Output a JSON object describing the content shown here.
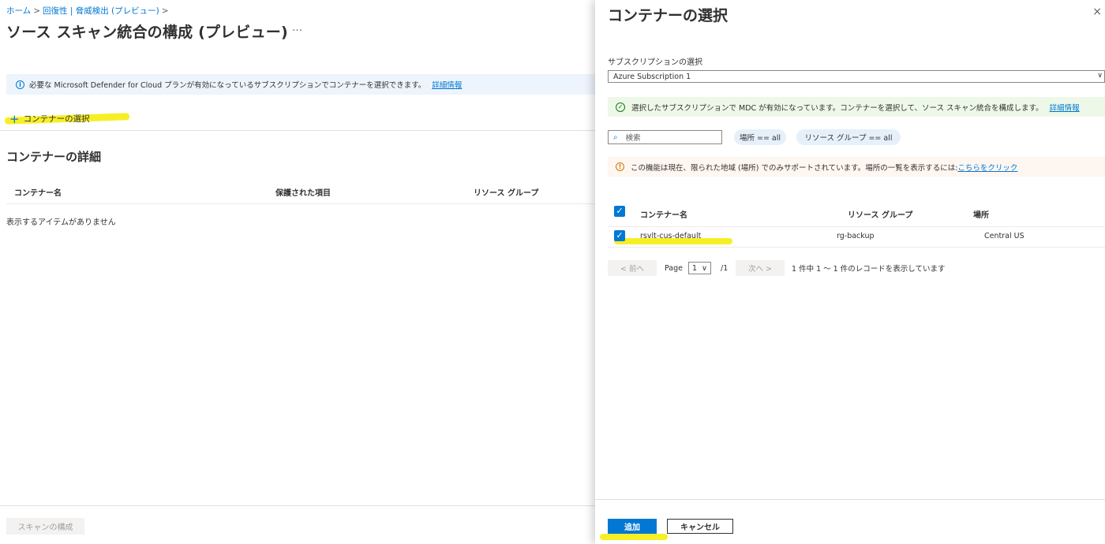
{
  "breadcrumb": {
    "home": "ホーム",
    "sep": ">",
    "resilience": "回復性 | 脅威検出 (プレビュー)",
    "tail": ">"
  },
  "page": {
    "title": "ソース スキャン統合の構成 (プレビュー)",
    "more": "…"
  },
  "info": {
    "text": "必要な Microsoft Defender for Cloud プランが有効になっているサブスクリプションでコンテナーを選択できます。",
    "link": "詳細情報",
    "icon": "i"
  },
  "toolbar": {
    "add_label": "コンテナーの選択",
    "add_icon": "+"
  },
  "details": {
    "title": "コンテナーの詳細",
    "columns": [
      "コンテナー名",
      "保護された項目",
      "リソース グループ"
    ],
    "empty": "表示するアイテムがありません"
  },
  "footer": {
    "scan_label": "スキャンの構成"
  },
  "panel": {
    "title": "コンテナーの選択",
    "close": "×",
    "subscription_label": "サブスクリプションの選択",
    "subscription_value": "Azure Subscription 1",
    "ok_text": "選択したサブスクリプションで MDC が有効になっています。コンテナーを選択して、ソース スキャン統合を構成します。",
    "ok_link": "詳細情報",
    "search_placeholder": "検索",
    "filters": [
      "場所 == all",
      "リソース グループ == all"
    ],
    "warn_text": "この機能は現在、限られた地域 (場所) でのみサポートされています。場所の一覧を表示するには: ",
    "warn_link": "こちらをクリック",
    "table": {
      "headers": [
        "コンテナー名",
        "リソース グループ",
        "場所"
      ],
      "rows": [
        {
          "name": "rsvlt-cus-default",
          "group": "rg-backup",
          "location": "Central US"
        }
      ]
    },
    "pagination": {
      "prev": "< 前へ",
      "page_label": "Page",
      "page": "1",
      "of": "/1",
      "next": "次へ >",
      "summary": "1 件中 1 ～ 1 件のレコードを表示しています"
    },
    "add_label": "追加",
    "cancel_label": "キャンセル"
  },
  "colors": {
    "accent": "#0078d4",
    "highlight": "#f7ef25",
    "success": "#107c10",
    "warning": "#d47500"
  }
}
